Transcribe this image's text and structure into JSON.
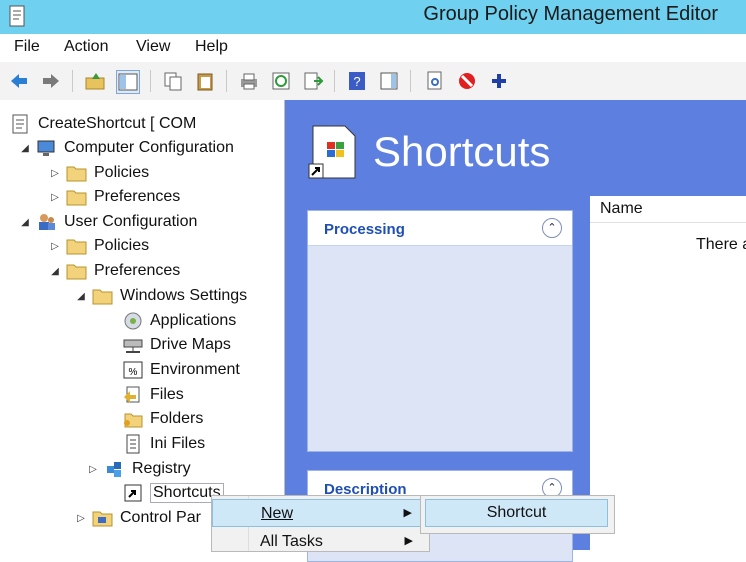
{
  "window": {
    "title": "Group Policy Management Editor"
  },
  "menu": [
    "File",
    "Action",
    "View",
    "Help"
  ],
  "toolbar": [
    "back-icon",
    "forward-icon",
    "up-folder-icon",
    "show-hide-tree-icon",
    "copy-icon",
    "paste-icon",
    "print-icon",
    "refresh-icon",
    "export-list-icon",
    "help-icon",
    "action-pane-icon",
    "properties-icon",
    "delete-icon",
    "add-icon"
  ],
  "tree": {
    "root": "CreateShortcut [            COM",
    "computer_config": "Computer Configuration",
    "cc_policies": "Policies",
    "cc_preferences": "Preferences",
    "user_config": "User Configuration",
    "uc_policies": "Policies",
    "uc_preferences": "Preferences",
    "windows_settings": "Windows Settings",
    "applications": "Applications",
    "drive_maps": "Drive Maps",
    "environment": "Environment",
    "files": "Files",
    "folders": "Folders",
    "ini_files": "Ini Files",
    "registry": "Registry",
    "shortcuts": "Shortcuts",
    "control_panel": "Control Par"
  },
  "right": {
    "title": "Shortcuts",
    "processing_label": "Processing",
    "description_label": "Description",
    "column_name": "Name",
    "empty_text": "There a"
  },
  "context_menu": {
    "new_label": "New",
    "all_tasks_label": "All Tasks",
    "submenu_shortcut": "Shortcut"
  }
}
